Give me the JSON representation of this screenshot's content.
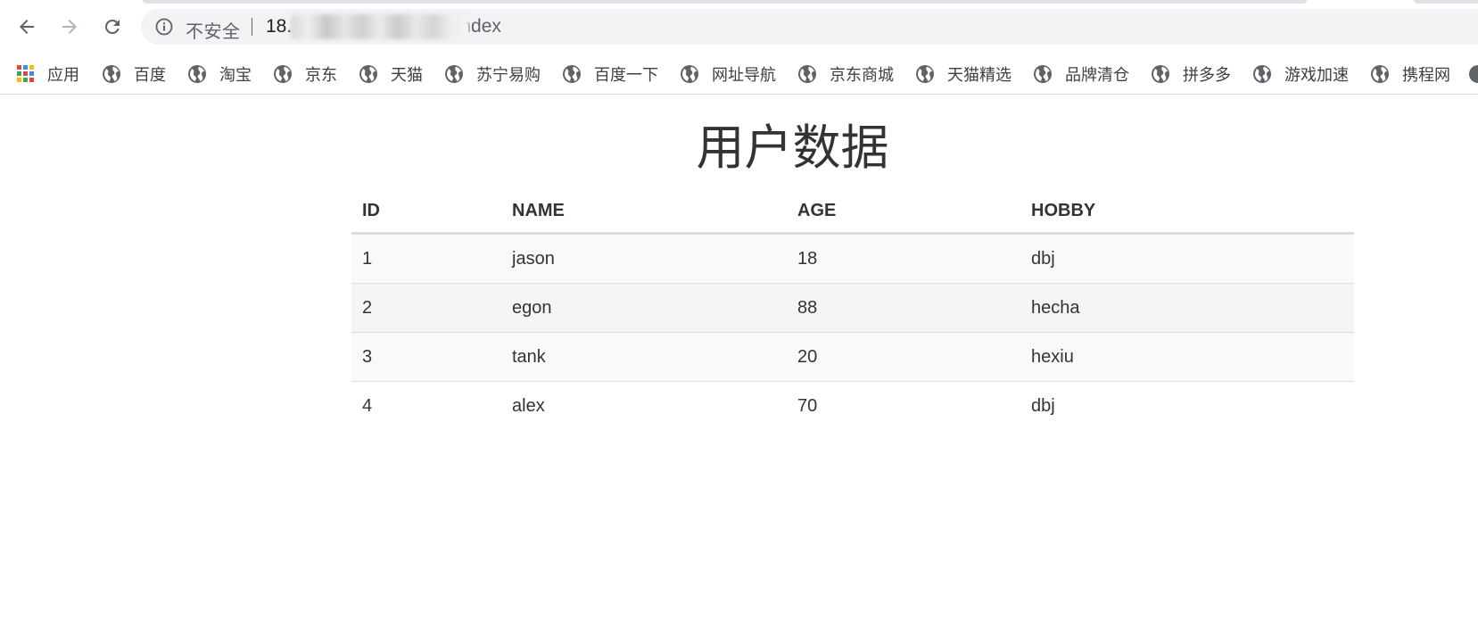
{
  "browser": {
    "security_label": "不安全",
    "url_host": "18.",
    "url_path": "0/index"
  },
  "bookmarks": [
    {
      "label": "应用",
      "icon": "apps-grid-icon"
    },
    {
      "label": "百度",
      "icon": "globe-icon"
    },
    {
      "label": "淘宝",
      "icon": "globe-icon"
    },
    {
      "label": "京东",
      "icon": "globe-icon"
    },
    {
      "label": "天猫",
      "icon": "globe-icon"
    },
    {
      "label": "苏宁易购",
      "icon": "globe-icon"
    },
    {
      "label": "百度一下",
      "icon": "globe-icon"
    },
    {
      "label": "网址导航",
      "icon": "globe-icon"
    },
    {
      "label": "京东商城",
      "icon": "globe-icon"
    },
    {
      "label": "天猫精选",
      "icon": "globe-icon"
    },
    {
      "label": "品牌清仓",
      "icon": "globe-icon"
    },
    {
      "label": "拼多多",
      "icon": "globe-icon"
    },
    {
      "label": "游戏加速",
      "icon": "globe-icon"
    },
    {
      "label": "携程网",
      "icon": "globe-icon"
    }
  ],
  "page": {
    "title": "用户数据",
    "table": {
      "headers": [
        "ID",
        "NAME",
        "AGE",
        "HOBBY"
      ],
      "rows": [
        [
          "1",
          "jason",
          "18",
          "dbj"
        ],
        [
          "2",
          "egon",
          "88",
          "hecha"
        ],
        [
          "3",
          "tank",
          "20",
          "hexiu"
        ],
        [
          "4",
          "alex",
          "70",
          "dbj"
        ]
      ]
    }
  },
  "colors": {
    "stripe": "#f9f9f9",
    "border": "#dddddd",
    "text": "#333333",
    "omnibox": "#f1f3f4"
  }
}
